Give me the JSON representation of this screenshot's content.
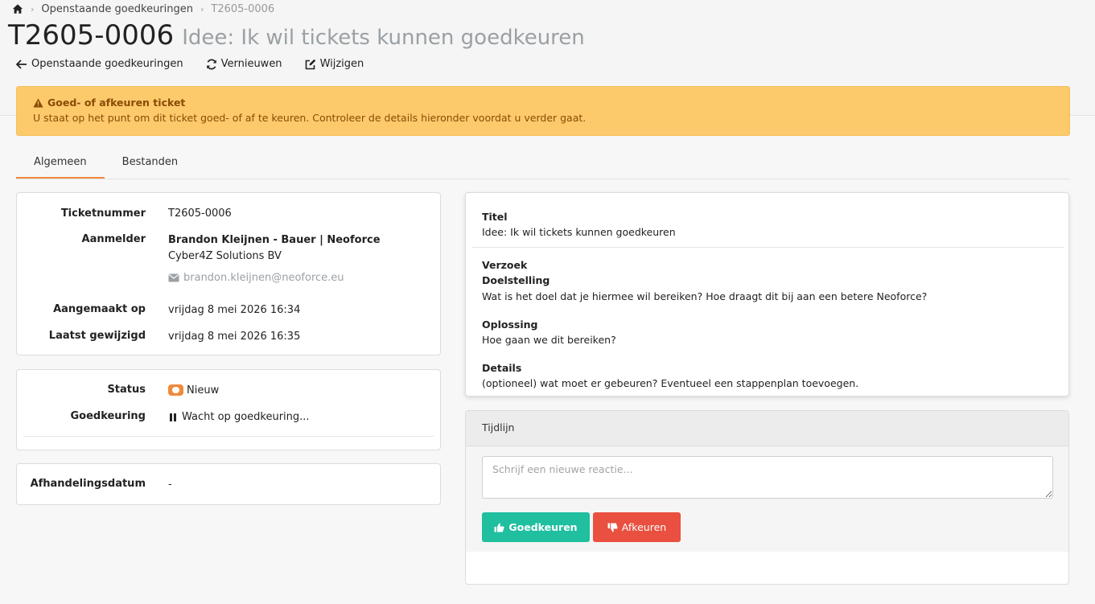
{
  "breadcrumb": {
    "parent": "Openstaande goedkeuringen",
    "current": "T2605-0006"
  },
  "header": {
    "ticket_number": "T2605-0006",
    "ticket_title": "Idee: Ik wil tickets kunnen goedkeuren"
  },
  "actions": {
    "back": "Openstaande goedkeuringen",
    "refresh": "Vernieuwen",
    "edit": "Wijzigen"
  },
  "alert": {
    "title": "Goed- of afkeuren ticket",
    "message": "U staat op het punt om dit ticket goed- of af te keuren. Controleer de details hieronder voordat u verder gaat.",
    "color": "#fcca6b"
  },
  "tabs": [
    {
      "label": "Algemeen",
      "active": true
    },
    {
      "label": "Bestanden",
      "active": false
    }
  ],
  "details": {
    "ticketnummer_label": "Ticketnummer",
    "ticketnummer": "T2605-0006",
    "aanmelder_label": "Aanmelder",
    "aanmelder_name": "Brandon Kleijnen - Bauer | Neoforce",
    "aanmelder_company": "Cyber4Z Solutions BV",
    "aanmelder_email": "brandon.kleijnen@neoforce.eu",
    "aangemaakt_label": "Aangemaakt op",
    "aangemaakt": "vrijdag 8 mei 2026 16:34",
    "gewijzigd_label": "Laatst gewijzigd",
    "gewijzigd": "vrijdag 8 mei 2026 16:35"
  },
  "status": {
    "status_label": "Status",
    "status": "Nieuw",
    "status_color": "#f08a3c",
    "goedkeuring_label": "Goedkeuring",
    "goedkeuring": "Wacht op goedkeuring..."
  },
  "afhandeling": {
    "label": "Afhandelingsdatum",
    "value": "-"
  },
  "request": {
    "titel_label": "Titel",
    "titel": "Idee: Ik wil tickets kunnen goedkeuren",
    "verzoek_label": "Verzoek",
    "doel_label": "Doelstelling",
    "doel": "Wat is het doel dat je hiermee wil bereiken? Hoe draagt dit bij aan een betere Neoforce?",
    "oplossing_label": "Oplossing",
    "oplossing": "Hoe gaan we dit bereiken?",
    "details_label": "Details",
    "details": "(optioneel) wat moet er gebeuren? Eventueel een stappenplan toevoegen."
  },
  "timeline": {
    "title": "Tijdlijn",
    "placeholder": "Schrijf een nieuwe reactie...",
    "approve_label": "Goedkeuren",
    "approve_color": "#1fbf9f",
    "reject_label": "Afkeuren",
    "reject_color": "#e9503f"
  }
}
